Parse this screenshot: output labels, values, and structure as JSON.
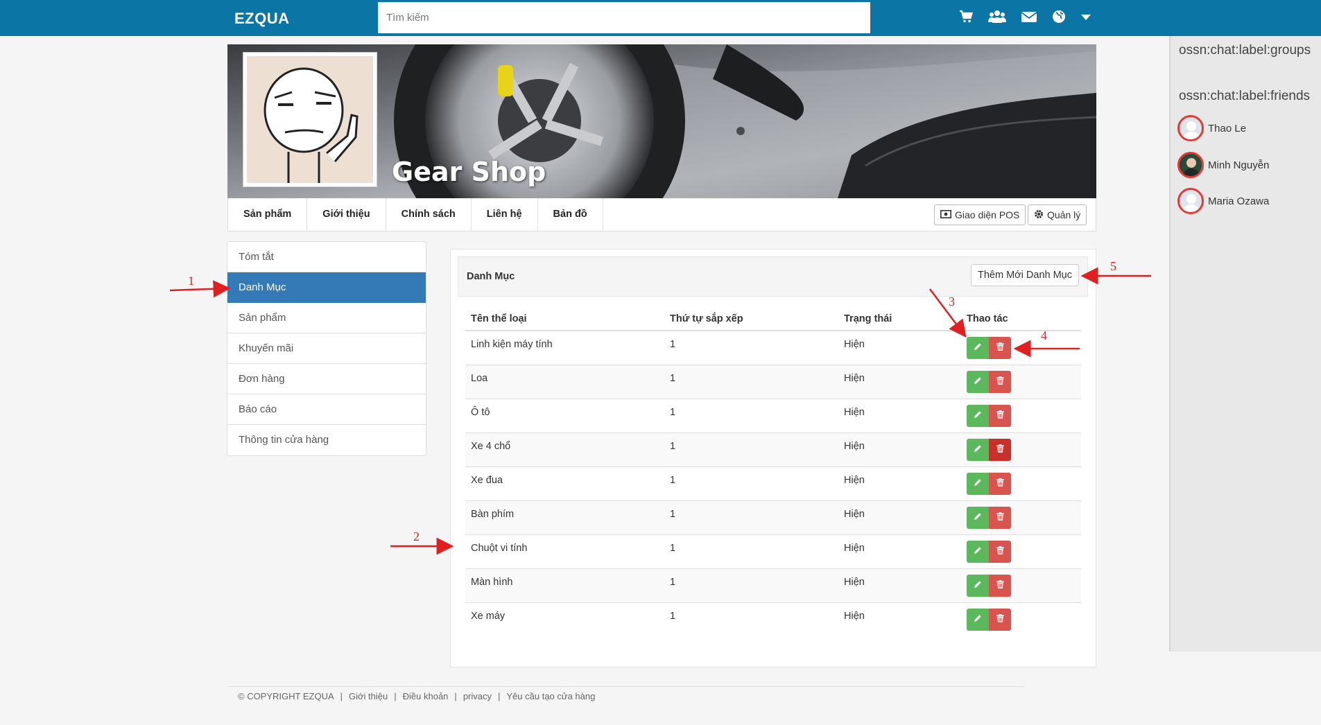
{
  "topbar": {
    "logo": "EZQUA",
    "search_placeholder": "Tìm kiếm",
    "icons": [
      "cart-icon",
      "groups-icon",
      "envelope-icon",
      "globe-icon",
      "caret-down-icon"
    ],
    "color": "#0b75a6"
  },
  "cover": {
    "shop_name": "Gear Shop"
  },
  "shop_nav": {
    "tabs": [
      "Sản phẩm",
      "Giới thiệu",
      "Chính sách",
      "Liên hệ",
      "Bản đồ"
    ],
    "pos_button": "Giao diện POS",
    "manage_button": "Quản lý"
  },
  "left_menu": {
    "items": [
      "Tóm tắt",
      "Danh Mục",
      "Sản phẩm",
      "Khuyến mãi",
      "Đơn hàng",
      "Báo cáo",
      "Thông tin cửa hàng"
    ],
    "active_index": 1,
    "active_color": "#337ab7"
  },
  "panel": {
    "title": "Danh Mục",
    "add_button": "Thêm Mới Danh Mục",
    "columns": [
      "Tên thể loại",
      "Thứ tự sắp xếp",
      "Trạng thái",
      "Thao tác"
    ],
    "rows": [
      {
        "name": "Linh kiện máy tính",
        "order": "1",
        "status": "Hiện"
      },
      {
        "name": "Loa",
        "order": "1",
        "status": "Hiện"
      },
      {
        "name": "Ô tô",
        "order": "1",
        "status": "Hiện"
      },
      {
        "name": "Xe 4 chổ",
        "order": "1",
        "status": "Hiện"
      },
      {
        "name": "Xe đua",
        "order": "1",
        "status": "Hiện"
      },
      {
        "name": "Bàn phím",
        "order": "1",
        "status": "Hiện"
      },
      {
        "name": "Chuột vi tính",
        "order": "1",
        "status": "Hiện"
      },
      {
        "name": "Màn hình",
        "order": "1",
        "status": "Hiện"
      },
      {
        "name": "Xe máy",
        "order": "1",
        "status": "Hiện"
      }
    ],
    "edit_color": "#5cb85c",
    "delete_color": "#d9534f"
  },
  "chat": {
    "groups_label": "ossn:chat:label:groups",
    "friends_label": "ossn:chat:label:friends",
    "friends": [
      "Thao Le",
      "Minh Nguyễn",
      "Maria Ozawa"
    ]
  },
  "footer": {
    "copyright": "© COPYRIGHT EZQUA",
    "links": [
      "Giới thiệu",
      "Điều khoản",
      "privacy",
      "Yêu cầu tạo cửa hàng"
    ]
  },
  "annotations": {
    "labels": [
      "1",
      "2",
      "3",
      "4",
      "5"
    ],
    "color": "#e02020"
  }
}
